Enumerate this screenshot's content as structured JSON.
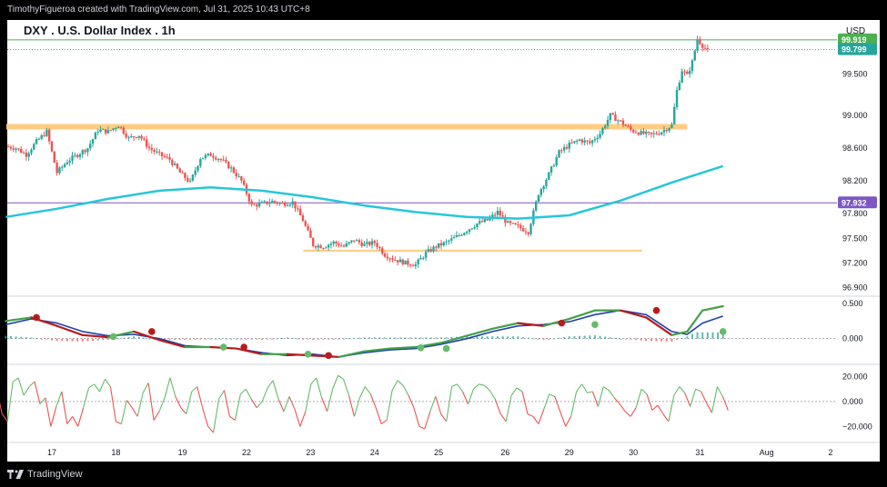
{
  "header": {
    "attribution": "TimothyFigueroa created with TradingView.com, Jul 31, 2025 10:43 UTC+8"
  },
  "footer": {
    "brand": "TradingView",
    "logo_icon": "tradingview-logo-icon"
  },
  "colors": {
    "background": "#ffffff",
    "frame": "#000000",
    "up_candle": "#26a69a",
    "down_candle": "#ef5350",
    "ma_line": "#26c6da",
    "support_resistance": "#ffcc80",
    "purple_level": "#7e57c2",
    "green_level": "#4caf50",
    "macd_fast": "#43a047",
    "macd_slow": "#1e40af",
    "cross_red": "#b71c1c",
    "rsi_up": "#66bb6a",
    "rsi_down": "#ef5350"
  },
  "chart_data": [
    {
      "type": "candlestick",
      "title": "DXY . U.S. Dollar Index . 1h",
      "currency": "USD",
      "x_ticks": [
        "17",
        "18",
        "19",
        "22",
        "23",
        "24",
        "25",
        "26",
        "29",
        "30",
        "31",
        "Aug",
        "2"
      ],
      "y_ticks": [
        "99.500",
        "99.000",
        "98.600",
        "98.200",
        "97.800",
        "97.500",
        "97.200",
        "96.900"
      ],
      "ylim": [
        96.85,
        100.05
      ],
      "price_labels": [
        {
          "label": "99.919",
          "value": 99.919,
          "color": "#4caf50"
        },
        {
          "label": "99.799",
          "value": 99.799,
          "color": "#26a69a"
        },
        {
          "label": "97.932",
          "value": 97.932,
          "color": "#7e57c2"
        }
      ],
      "horizontal_lines": [
        {
          "name": "resistance-band",
          "value": 98.86,
          "from": "17",
          "to": "31"
        },
        {
          "name": "support-line",
          "value": 97.35,
          "from": "23",
          "to": "29"
        },
        {
          "name": "purple-level",
          "value": 97.932
        },
        {
          "name": "green-level",
          "value": 99.919
        },
        {
          "name": "last-price",
          "value": 99.799
        }
      ],
      "close_path": [
        {
          "x": 0.0,
          "v": 98.62
        },
        {
          "x": 0.2,
          "v": 98.6
        },
        {
          "x": 0.4,
          "v": 98.52
        },
        {
          "x": 0.6,
          "v": 98.68
        },
        {
          "x": 0.8,
          "v": 98.8
        },
        {
          "x": 1.0,
          "v": 98.3
        },
        {
          "x": 1.2,
          "v": 98.44
        },
        {
          "x": 1.4,
          "v": 98.52
        },
        {
          "x": 1.6,
          "v": 98.6
        },
        {
          "x": 1.8,
          "v": 98.82
        },
        {
          "x": 2.0,
          "v": 98.8
        },
        {
          "x": 2.2,
          "v": 98.88
        },
        {
          "x": 2.4,
          "v": 98.72
        },
        {
          "x": 2.6,
          "v": 98.76
        },
        {
          "x": 2.8,
          "v": 98.6
        },
        {
          "x": 3.0,
          "v": 98.52
        },
        {
          "x": 3.2,
          "v": 98.46
        },
        {
          "x": 3.4,
          "v": 98.3
        },
        {
          "x": 3.6,
          "v": 98.18
        },
        {
          "x": 3.8,
          "v": 98.48
        },
        {
          "x": 4.0,
          "v": 98.52
        },
        {
          "x": 4.2,
          "v": 98.46
        },
        {
          "x": 4.4,
          "v": 98.35
        },
        {
          "x": 4.6,
          "v": 98.2
        },
        {
          "x": 4.8,
          "v": 97.9
        },
        {
          "x": 5.0,
          "v": 97.92
        },
        {
          "x": 5.2,
          "v": 97.95
        },
        {
          "x": 5.4,
          "v": 97.92
        },
        {
          "x": 5.6,
          "v": 97.94
        },
        {
          "x": 5.8,
          "v": 97.72
        },
        {
          "x": 6.0,
          "v": 97.42
        },
        {
          "x": 6.2,
          "v": 97.4
        },
        {
          "x": 6.4,
          "v": 97.45
        },
        {
          "x": 6.6,
          "v": 97.4
        },
        {
          "x": 6.8,
          "v": 97.48
        },
        {
          "x": 7.0,
          "v": 97.42
        },
        {
          "x": 7.2,
          "v": 97.45
        },
        {
          "x": 7.4,
          "v": 97.3
        },
        {
          "x": 7.6,
          "v": 97.24
        },
        {
          "x": 7.8,
          "v": 97.2
        },
        {
          "x": 8.0,
          "v": 97.18
        },
        {
          "x": 8.2,
          "v": 97.32
        },
        {
          "x": 8.4,
          "v": 97.4
        },
        {
          "x": 8.6,
          "v": 97.45
        },
        {
          "x": 8.8,
          "v": 97.52
        },
        {
          "x": 9.0,
          "v": 97.6
        },
        {
          "x": 9.2,
          "v": 97.68
        },
        {
          "x": 9.4,
          "v": 97.72
        },
        {
          "x": 9.6,
          "v": 97.82
        },
        {
          "x": 9.8,
          "v": 97.68
        },
        {
          "x": 10.0,
          "v": 97.64
        },
        {
          "x": 10.2,
          "v": 97.58
        },
        {
          "x": 10.4,
          "v": 98.05
        },
        {
          "x": 10.6,
          "v": 98.28
        },
        {
          "x": 10.8,
          "v": 98.55
        },
        {
          "x": 11.0,
          "v": 98.64
        },
        {
          "x": 11.2,
          "v": 98.7
        },
        {
          "x": 11.4,
          "v": 98.66
        },
        {
          "x": 11.6,
          "v": 98.78
        },
        {
          "x": 11.8,
          "v": 99.0
        },
        {
          "x": 12.0,
          "v": 98.92
        },
        {
          "x": 12.2,
          "v": 98.82
        },
        {
          "x": 12.4,
          "v": 98.78
        },
        {
          "x": 12.6,
          "v": 98.76
        },
        {
          "x": 12.8,
          "v": 98.8
        },
        {
          "x": 13.0,
          "v": 98.88
        },
        {
          "x": 13.1,
          "v": 99.3
        },
        {
          "x": 13.2,
          "v": 99.55
        },
        {
          "x": 13.3,
          "v": 99.48
        },
        {
          "x": 13.4,
          "v": 99.65
        },
        {
          "x": 13.5,
          "v": 99.93
        },
        {
          "x": 13.6,
          "v": 99.85
        },
        {
          "x": 13.7,
          "v": 99.79
        }
      ],
      "ma_line": [
        {
          "x": 0.0,
          "v": 97.76
        },
        {
          "x": 1.0,
          "v": 97.86
        },
        {
          "x": 2.0,
          "v": 97.98
        },
        {
          "x": 3.0,
          "v": 98.08
        },
        {
          "x": 4.0,
          "v": 98.12
        },
        {
          "x": 5.0,
          "v": 98.08
        },
        {
          "x": 6.0,
          "v": 98.0
        },
        {
          "x": 7.0,
          "v": 97.9
        },
        {
          "x": 8.0,
          "v": 97.82
        },
        {
          "x": 9.0,
          "v": 97.76
        },
        {
          "x": 10.0,
          "v": 97.74
        },
        {
          "x": 11.0,
          "v": 97.78
        },
        {
          "x": 12.0,
          "v": 97.96
        },
        {
          "x": 13.0,
          "v": 98.18
        },
        {
          "x": 14.0,
          "v": 98.38
        }
      ],
      "x_index_at_tick": {
        "17": 0.9,
        "18": 2.15,
        "19": 3.45,
        "22": 4.7,
        "23": 5.95,
        "24": 7.2,
        "25": 8.45,
        "26": 9.75,
        "29": 11.0,
        "30": 12.25,
        "31": 13.55,
        "Aug": 14.85,
        "2": 16.1
      }
    },
    {
      "type": "line",
      "name": "macd-oscillator",
      "y_ticks": [
        "0.500",
        "0.000"
      ],
      "ylim": [
        -0.3,
        0.55
      ],
      "fast": [
        {
          "x": 0.0,
          "v": 0.25
        },
        {
          "x": 0.5,
          "v": 0.3
        },
        {
          "x": 1.0,
          "v": 0.18
        },
        {
          "x": 1.5,
          "v": 0.05
        },
        {
          "x": 2.0,
          "v": 0.02
        },
        {
          "x": 2.5,
          "v": 0.1
        },
        {
          "x": 3.0,
          "v": -0.02
        },
        {
          "x": 3.5,
          "v": -0.12
        },
        {
          "x": 4.0,
          "v": -0.12
        },
        {
          "x": 4.5,
          "v": -0.14
        },
        {
          "x": 5.0,
          "v": -0.22
        },
        {
          "x": 5.5,
          "v": -0.22
        },
        {
          "x": 6.0,
          "v": -0.24
        },
        {
          "x": 6.5,
          "v": -0.26
        },
        {
          "x": 7.0,
          "v": -0.18
        },
        {
          "x": 7.5,
          "v": -0.14
        },
        {
          "x": 8.0,
          "v": -0.12
        },
        {
          "x": 8.5,
          "v": -0.06
        },
        {
          "x": 9.0,
          "v": 0.04
        },
        {
          "x": 9.5,
          "v": 0.14
        },
        {
          "x": 10.0,
          "v": 0.22
        },
        {
          "x": 10.5,
          "v": 0.18
        },
        {
          "x": 11.0,
          "v": 0.28
        },
        {
          "x": 11.5,
          "v": 0.4
        },
        {
          "x": 12.0,
          "v": 0.4
        },
        {
          "x": 12.5,
          "v": 0.3
        },
        {
          "x": 13.0,
          "v": 0.05
        },
        {
          "x": 13.3,
          "v": 0.1
        },
        {
          "x": 13.6,
          "v": 0.4
        },
        {
          "x": 14.0,
          "v": 0.46
        }
      ],
      "slow": [
        {
          "x": 0.0,
          "v": 0.2
        },
        {
          "x": 0.5,
          "v": 0.28
        },
        {
          "x": 1.0,
          "v": 0.22
        },
        {
          "x": 1.5,
          "v": 0.1
        },
        {
          "x": 2.0,
          "v": 0.04
        },
        {
          "x": 2.5,
          "v": 0.06
        },
        {
          "x": 3.0,
          "v": 0.0
        },
        {
          "x": 3.5,
          "v": -0.1
        },
        {
          "x": 4.0,
          "v": -0.12
        },
        {
          "x": 4.5,
          "v": -0.14
        },
        {
          "x": 5.0,
          "v": -0.2
        },
        {
          "x": 5.5,
          "v": -0.24
        },
        {
          "x": 6.0,
          "v": -0.22
        },
        {
          "x": 6.5,
          "v": -0.26
        },
        {
          "x": 7.0,
          "v": -0.2
        },
        {
          "x": 7.5,
          "v": -0.16
        },
        {
          "x": 8.0,
          "v": -0.14
        },
        {
          "x": 8.5,
          "v": -0.08
        },
        {
          "x": 9.0,
          "v": 0.0
        },
        {
          "x": 9.5,
          "v": 0.1
        },
        {
          "x": 10.0,
          "v": 0.18
        },
        {
          "x": 10.5,
          "v": 0.2
        },
        {
          "x": 11.0,
          "v": 0.24
        },
        {
          "x": 11.5,
          "v": 0.34
        },
        {
          "x": 12.0,
          "v": 0.4
        },
        {
          "x": 12.5,
          "v": 0.34
        },
        {
          "x": 13.0,
          "v": 0.1
        },
        {
          "x": 13.3,
          "v": 0.06
        },
        {
          "x": 13.6,
          "v": 0.22
        },
        {
          "x": 14.0,
          "v": 0.32
        }
      ],
      "histogram_peak": 0.09,
      "crosses": [
        {
          "x": 0.6,
          "v": 0.3,
          "dir": "down"
        },
        {
          "x": 2.1,
          "v": 0.03,
          "dir": "up"
        },
        {
          "x": 2.85,
          "v": 0.1,
          "dir": "down"
        },
        {
          "x": 4.25,
          "v": -0.12,
          "dir": "up"
        },
        {
          "x": 4.65,
          "v": -0.12,
          "dir": "down"
        },
        {
          "x": 5.9,
          "v": -0.22,
          "dir": "up"
        },
        {
          "x": 6.3,
          "v": -0.24,
          "dir": "down"
        },
        {
          "x": 8.1,
          "v": -0.13,
          "dir": "up"
        },
        {
          "x": 8.6,
          "v": -0.14,
          "dir": "up"
        },
        {
          "x": 10.85,
          "v": 0.22,
          "dir": "down"
        },
        {
          "x": 11.5,
          "v": 0.2,
          "dir": "up"
        },
        {
          "x": 12.7,
          "v": 0.4,
          "dir": "down"
        },
        {
          "x": 14.0,
          "v": 0.1,
          "dir": "up"
        }
      ]
    },
    {
      "type": "line",
      "name": "momentum-oscillator",
      "y_ticks": [
        "20.000",
        "0.000",
        "−20.000"
      ],
      "ylim": [
        -30,
        27
      ],
      "values": [
        -8,
        -14,
        -20,
        5,
        10,
        -10,
        -16,
        16,
        19,
        5,
        12,
        16,
        -2,
        3,
        -20,
        -4,
        8,
        -18,
        -12,
        -20,
        -5,
        11,
        14,
        8,
        18,
        12,
        -16,
        -18,
        1,
        -5,
        -12,
        7,
        15,
        -15,
        -8,
        3,
        19,
        4,
        -5,
        -10,
        8,
        12,
        -5,
        -20,
        -25,
        2,
        9,
        -12,
        -15,
        6,
        10,
        2,
        -5,
        0,
        11,
        17,
        2,
        -8,
        4,
        -6,
        -20,
        -8,
        14,
        19,
        3,
        -8,
        10,
        21,
        18,
        5,
        -12,
        3,
        12,
        6,
        -5,
        -18,
        -15,
        9,
        17,
        13,
        5,
        -5,
        -20,
        -22,
        -8,
        4,
        -10,
        -16,
        12,
        14,
        8,
        -2,
        10,
        14,
        13,
        9,
        2,
        -10,
        -16,
        5,
        11,
        8,
        -10,
        -12,
        -18,
        -6,
        6,
        4,
        -8,
        -20,
        -12,
        8,
        14,
        7,
        8,
        -4,
        12,
        9,
        3,
        -2,
        -8,
        -12,
        -5,
        10,
        6,
        -7,
        -3,
        -10,
        -16,
        5,
        12,
        7,
        -4,
        10,
        8,
        -1,
        -9,
        12,
        4,
        -7
      ]
    }
  ]
}
